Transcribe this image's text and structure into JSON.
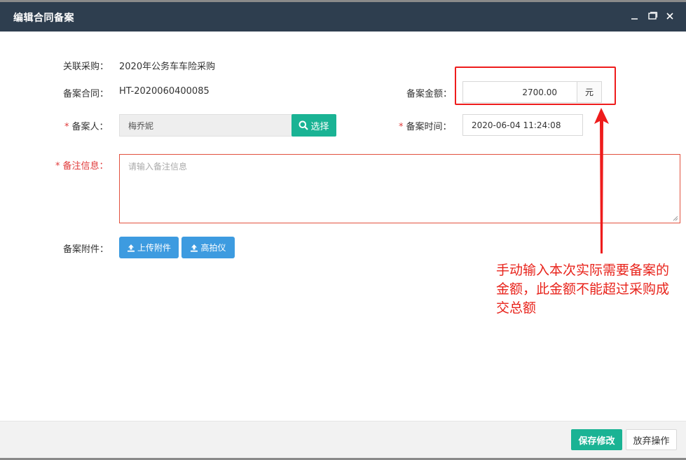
{
  "dialog": {
    "title": "编辑合同备案"
  },
  "form": {
    "related_purchase": {
      "label": "关联采购：",
      "value": "2020年公务车车险采购"
    },
    "contract": {
      "label": "备案合同：",
      "value": "HT-2020060400085"
    },
    "amount": {
      "label": "备案金额：",
      "value": "2700.00",
      "unit": "元"
    },
    "person": {
      "required_mark": "*",
      "label": "备案人：",
      "value": "梅乔妮",
      "select_label": "选择"
    },
    "time": {
      "required_mark": "*",
      "label": "备案时间：",
      "value": "2020-06-04 11:24:08"
    },
    "remark": {
      "required_mark": "*",
      "label": "备注信息：",
      "placeholder": "请输入备注信息"
    },
    "attachment": {
      "label": "备案附件：",
      "upload_label": "上传附件",
      "scanner_label": "高拍仪"
    }
  },
  "annotation": {
    "text": "手动输入本次实际需要备案的金额，此金额不能超过采购成交总额",
    "color": "#e8231b"
  },
  "footer": {
    "save_label": "保存修改",
    "cancel_label": "放弃操作"
  },
  "colors": {
    "titlebar": "#2e3e4f",
    "primary": "#1ab394",
    "upload": "#3d9be0",
    "required": "#e03a3a"
  }
}
